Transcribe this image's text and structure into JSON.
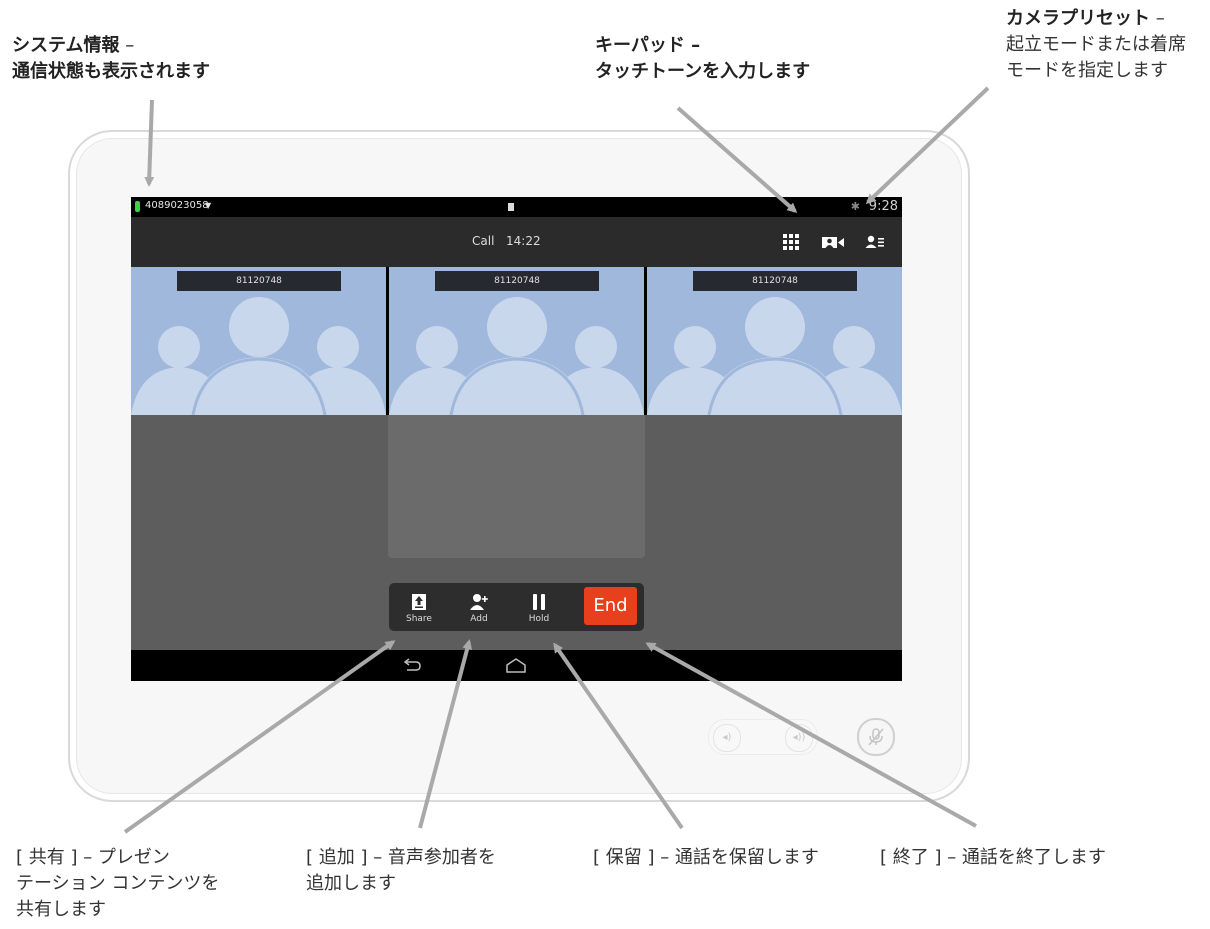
{
  "callouts": {
    "system_info_title": "システム情報",
    "system_info_dash": " –",
    "system_info_desc": "通信状態も表示されます",
    "keypad_title": "キーパッド",
    "keypad_dash": " –",
    "keypad_desc": "タッチトーンを入力します",
    "camera_title": "カメラプリセット",
    "camera_dash": " –",
    "camera_desc_1": "起立モードまたは着席",
    "camera_desc_2": "モードを指定します",
    "share_1": "[ 共有 ] – プレゼン",
    "share_2": "テーション コンテンツを",
    "share_3": "共有します",
    "add_1": "[ 追加 ] – 音声参加者を",
    "add_2": "追加します",
    "hold_1": "[ 保留 ] – 通話を保留します",
    "end_1": "[ 終了 ] – 通話を終了します"
  },
  "status_bar": {
    "number": "4089023058",
    "dropdown": "▼",
    "time": "9:28",
    "bt": "✱"
  },
  "action_bar": {
    "call_label": "Call",
    "call_time": "14:22"
  },
  "tiles": [
    {
      "name": "81120748"
    },
    {
      "name": "81120748"
    },
    {
      "name": "81120748"
    }
  ],
  "controls": {
    "share": "Share",
    "add": "Add",
    "hold": "Hold",
    "end": "End"
  },
  "hardware": {
    "vol_down": "◂)",
    "vol_up": "◂))"
  },
  "colors": {
    "end_button": "#e8401c",
    "tile_bg": "#9fb8dc",
    "battery": "#3fd13f",
    "arrow": "#a9a9a9"
  }
}
